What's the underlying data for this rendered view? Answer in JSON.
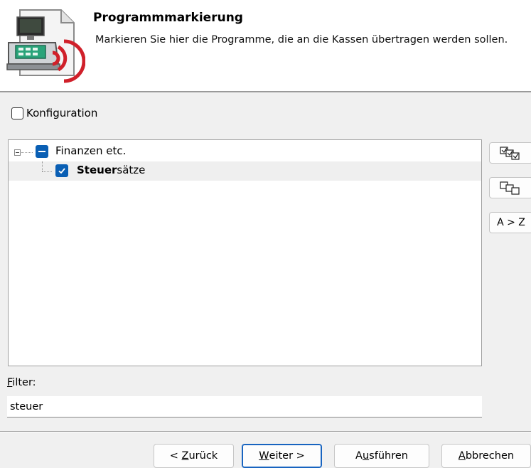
{
  "header": {
    "title": "Programmmarkierung",
    "subtitle": "Markieren Sie hier die Programme, die an die Kassen übertragen werden sollen.",
    "icon": "cash-register-wireless-icon"
  },
  "config": {
    "label": "Konfiguration",
    "checked": false
  },
  "tree": {
    "nodes": [
      {
        "label": "Finanzen etc.",
        "state": "partial",
        "expanded": true
      },
      {
        "label_match": "Steuer",
        "label_rest": "sätze",
        "state": "checked",
        "selected": true
      }
    ]
  },
  "side_buttons": {
    "check_all_icon": "check-all-icon",
    "uncheck_all_icon": "uncheck-all-icon",
    "sort_label": "A > Z"
  },
  "filter": {
    "label_mnemonic": "F",
    "label_rest": "ilter:",
    "value": "steuer"
  },
  "footer": {
    "back": {
      "prefix": "< ",
      "mnemonic": "Z",
      "rest": "urück"
    },
    "next": {
      "mnemonic": "W",
      "rest": "eiter >"
    },
    "run": {
      "prefix": "A",
      "mnemonic": "u",
      "rest": "sführen"
    },
    "cancel": {
      "mnemonic": "A",
      "rest": "bbrechen"
    }
  },
  "colors": {
    "accent": "#0a5fb4",
    "default_button_border": "#1864c0"
  }
}
